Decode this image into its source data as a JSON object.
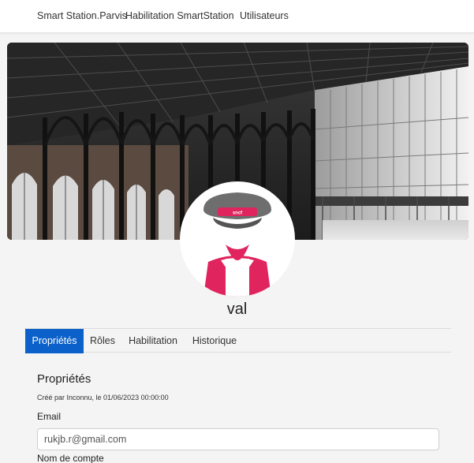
{
  "nav": {
    "items": [
      {
        "label": "Smart Station.Parvis"
      },
      {
        "label": "Habilitation SmartStation"
      },
      {
        "label": "Utilisateurs"
      }
    ]
  },
  "profile": {
    "username": "val",
    "avatar_badge": "sncf"
  },
  "tabs": [
    {
      "label": "Propriétés",
      "active": true
    },
    {
      "label": "Rôles",
      "active": false
    },
    {
      "label": "Habilitation",
      "active": false
    },
    {
      "label": "Historique",
      "active": false
    }
  ],
  "properties": {
    "title": "Propriétés",
    "created_info": "Créé par Inconnu, le 01/06/2023 00:00:00",
    "email_label": "Email",
    "email_value": "rukjb.r@gmail.com",
    "account_label": "Nom de compte"
  },
  "colors": {
    "accent": "#0b61c9",
    "brand": "#e0245e"
  }
}
